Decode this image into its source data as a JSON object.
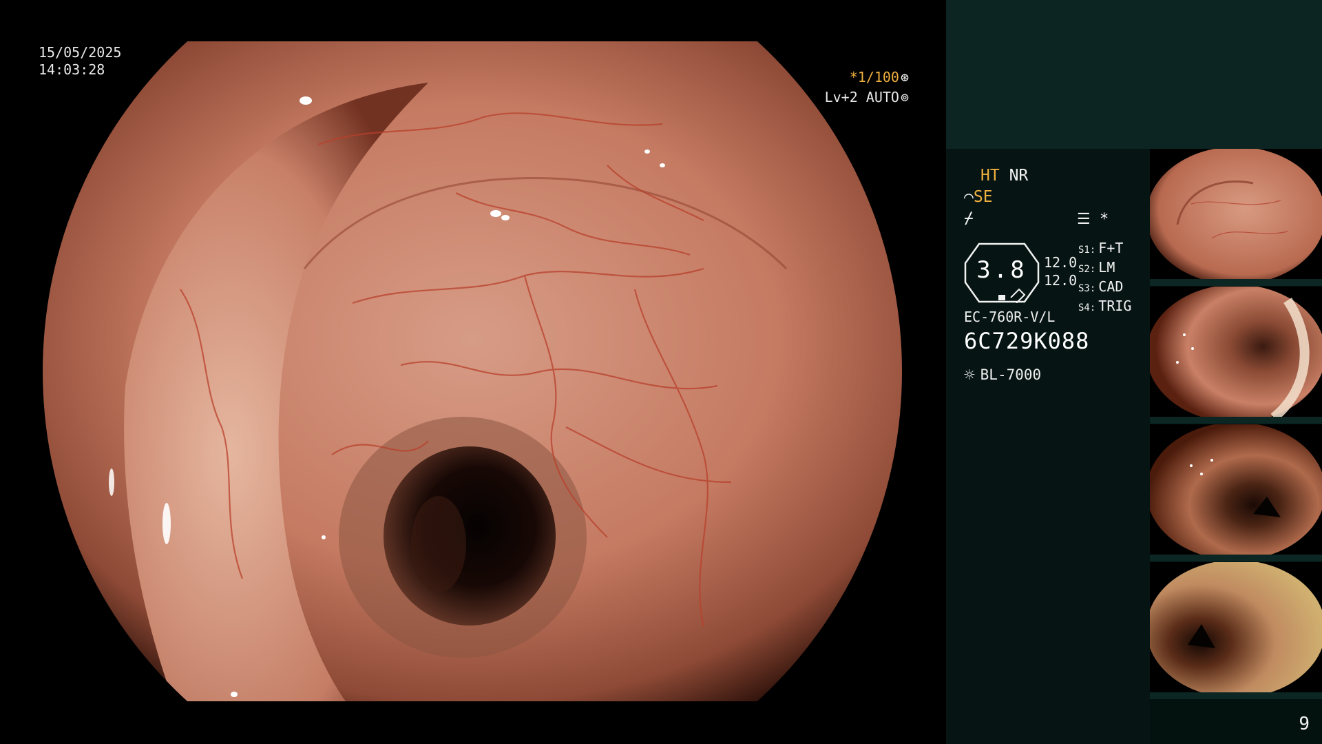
{
  "overlay": {
    "date": "15/05/2025",
    "time": "14:03:28",
    "shutter": "*1/100",
    "shutter_icon": "aperture-icon",
    "level": "Lv+2 AUTO",
    "level_icon": "auto-iris-icon"
  },
  "panel": {
    "mode_ht": "HT",
    "mode_nr": "NR",
    "mode_se": "SE",
    "freeze_icon": "freeze-icon",
    "menu_icon": "menu-icon",
    "asterisk": "*",
    "gauge_value": "3.8",
    "gauge_side_1": "12.0",
    "gauge_side_2": "12.0",
    "settings": [
      {
        "key": "S1:",
        "value": "F+T"
      },
      {
        "key": "S2:",
        "value": "LM"
      },
      {
        "key": "S3:",
        "value": "CAD"
      },
      {
        "key": "S4:",
        "value": "TRIG"
      }
    ],
    "scope_model": "EC-760R-V/L",
    "scope_serial": "6C729K088",
    "light_source": "BL-7000",
    "page_number": "9"
  },
  "colors": {
    "accent": "#f0b040",
    "panel_top": "#0c2422",
    "panel_bg": "#03110f"
  }
}
